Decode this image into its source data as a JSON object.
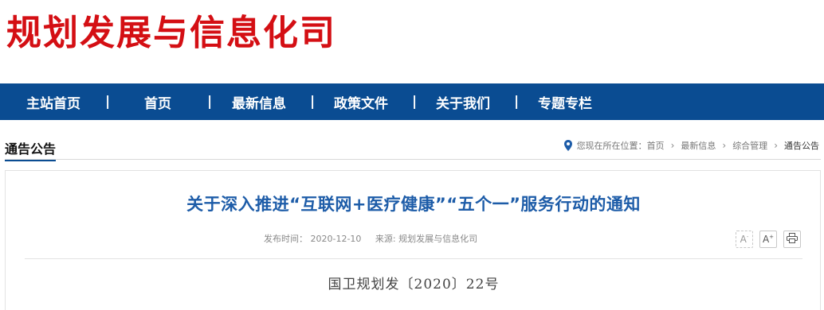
{
  "header": {
    "site_title": "规划发展与信息化司"
  },
  "nav": {
    "items": [
      {
        "label": "主站首页"
      },
      {
        "label": "首页"
      },
      {
        "label": "最新信息"
      },
      {
        "label": "政策文件"
      },
      {
        "label": "关于我们"
      },
      {
        "label": "专题专栏"
      }
    ],
    "separator": "|"
  },
  "section": {
    "title": "通告公告"
  },
  "breadcrumb": {
    "prefix": "您现在所在位置：",
    "items": [
      "首页",
      "最新信息",
      "综合管理",
      "通告公告"
    ],
    "separator": "›"
  },
  "article": {
    "title": "关于深入推进“互联网+医疗健康”“五个一”服务行动的通知",
    "publish_label": "发布时间：",
    "publish_date": "2020-12-10",
    "source_label": "来源: ",
    "source": "规划发展与信息化司",
    "doc_number": "国卫规划发〔2020〕22号"
  },
  "tools": {
    "font_decrease": "A",
    "font_increase": "A",
    "font_decrease_icon": "font-decrease-icon",
    "font_increase_icon": "font-increase-icon",
    "print_icon": "print-icon"
  },
  "colors": {
    "brand_red": "#d40f14",
    "nav_blue": "#0a4c92",
    "title_blue": "#1d5ca8"
  }
}
